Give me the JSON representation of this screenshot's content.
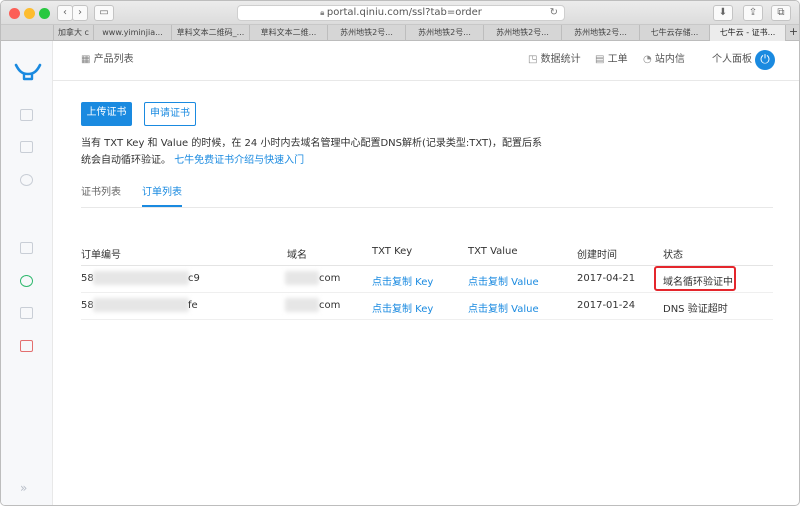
{
  "browser": {
    "url": "portal.qiniu.com/ssl?tab=order",
    "tabs": [
      "加拿大 c",
      "www.yiminjia...",
      "草料文本二维码_...",
      "草料文本二维...",
      "苏州地铁2号...",
      "苏州地铁2号...",
      "苏州地铁2号...",
      "苏州地铁2号...",
      "七牛云存储...",
      "七牛云 - 证书..."
    ]
  },
  "header": {
    "breadcrumb": "产品列表",
    "data_stats": "数据统计",
    "workorder": "工单",
    "messages": "站内信",
    "personal_panel": "个人面板"
  },
  "actions": {
    "upload": "上传证书",
    "apply": "申请证书"
  },
  "notice": {
    "line1": "当有 TXT Key 和 Value 的时候，在 24 小时内去域名管理中心配置DNS解析(记录类型:TXT)，配置后系",
    "line2": "统会自动循环验证。",
    "link": "七牛免费证书介绍与快速入门"
  },
  "subtabs": {
    "certs": "证书列表",
    "orders": "订单列表"
  },
  "table": {
    "headers": [
      "订单编号",
      "域名",
      "TXT Key",
      "TXT Value",
      "创建时间",
      "状态"
    ],
    "rows": [
      {
        "order_prefix": "58",
        "order_suffix": "c9",
        "domain_suffix": "com",
        "txt_key": "点击复制 Key",
        "txt_value": "点击复制 Value",
        "created": "2017-04-21",
        "status": "域名循环验证中"
      },
      {
        "order_prefix": "58",
        "order_suffix": "fe",
        "domain_suffix": "com",
        "txt_key": "点击复制 Key",
        "txt_value": "点击复制 Value",
        "created": "2017-01-24",
        "status": "DNS 验证超时"
      }
    ]
  },
  "colors": {
    "accent": "#1a8ae0",
    "highlight": "#e4262c",
    "logo": "#1a8ae0"
  }
}
